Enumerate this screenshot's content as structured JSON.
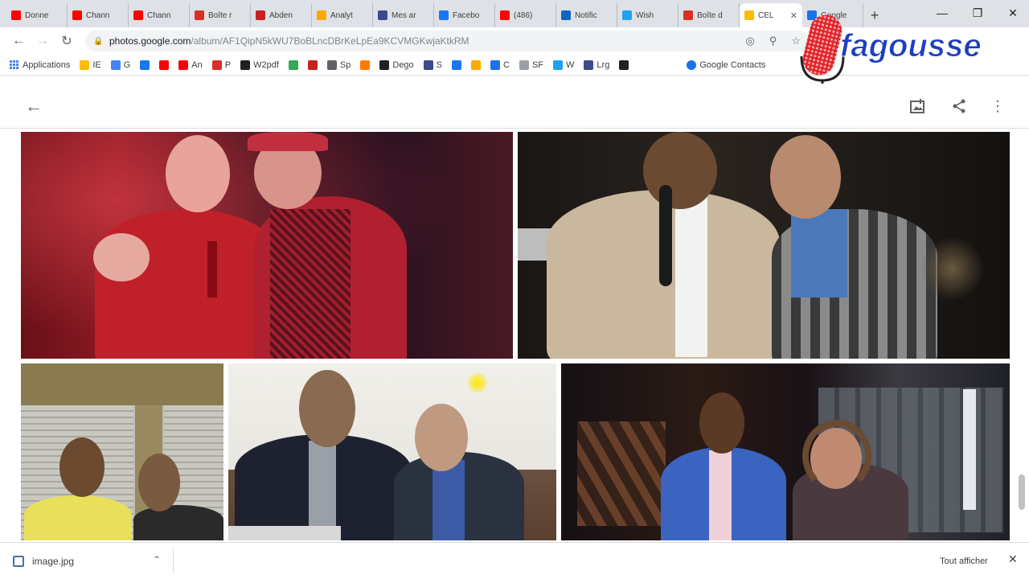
{
  "browser": {
    "tabs": [
      {
        "title": "Donne",
        "favicon": "youtube-icon",
        "color": "#ff0000"
      },
      {
        "title": "Chann",
        "favicon": "youtube-icon",
        "color": "#ff0000"
      },
      {
        "title": "Chann",
        "favicon": "youtube-icon",
        "color": "#ff0000"
      },
      {
        "title": "Boîte r",
        "favicon": "gmail-icon",
        "color": "#d93025"
      },
      {
        "title": "Abden",
        "favicon": "site-icon",
        "color": "#c5221f"
      },
      {
        "title": "Analyt",
        "favicon": "analytics-icon",
        "color": "#f9ab00"
      },
      {
        "title": "Mes ar",
        "favicon": "star-icon",
        "color": "#3c4b8c"
      },
      {
        "title": "Facebo",
        "favicon": "facebook-icon",
        "color": "#1877f2"
      },
      {
        "title": "(486)",
        "favicon": "youtube-icon",
        "color": "#ff0000"
      },
      {
        "title": "Notific",
        "favicon": "linkedin-icon",
        "color": "#0a66c2"
      },
      {
        "title": "Wish",
        "favicon": "twitter-icon",
        "color": "#1da1f2"
      },
      {
        "title": "Boîte d",
        "favicon": "gmail-icon",
        "color": "#d93025"
      },
      {
        "title": "CEL",
        "favicon": "google-photos-icon",
        "color": "#fbbc04",
        "active": true
      },
      {
        "title": "Google",
        "favicon": "google-docs-icon",
        "color": "#1a73e8"
      }
    ],
    "new_tab": "+",
    "url_host": "photos.google.com",
    "url_path": "/album/AF1QipN5kWU7BoBLncDBrKeLpEa9KCVMGKwjaKtkRM",
    "bookmarks": [
      {
        "label": "Applications",
        "icon": "apps-grid-icon",
        "color": "#4285f4"
      },
      {
        "label": "IE",
        "icon": "bookmark-icon",
        "color": "#fbbc04"
      },
      {
        "label": "G",
        "icon": "google-icon",
        "color": "#4285f4"
      },
      {
        "label": "",
        "icon": "facebook-icon",
        "color": "#1877f2"
      },
      {
        "label": "",
        "icon": "youtube-icon",
        "color": "#ff0000"
      },
      {
        "label": "An",
        "icon": "youtube-icon",
        "color": "#ff0000"
      },
      {
        "label": "P",
        "icon": "gmail-icon",
        "color": "#d93025"
      },
      {
        "label": "W2pdf",
        "icon": "dash-icon",
        "color": "#202124"
      },
      {
        "label": "",
        "icon": "map-pin-icon",
        "color": "#34a853"
      },
      {
        "label": "",
        "icon": "site-icon",
        "color": "#c5221f"
      },
      {
        "label": "Sp",
        "icon": "gauge-icon",
        "color": "#5f6368"
      },
      {
        "label": "",
        "icon": "orange-icon",
        "color": "#ff7900"
      },
      {
        "label": "Dego",
        "icon": "globe-icon",
        "color": "#202124"
      },
      {
        "label": "S",
        "icon": "star-icon",
        "color": "#3c4b8c"
      },
      {
        "label": "",
        "icon": "facebook-icon",
        "color": "#1877f2"
      },
      {
        "label": "",
        "icon": "analytics-icon",
        "color": "#f9ab00"
      },
      {
        "label": "C",
        "icon": "chevron-right-icon",
        "color": "#1a73e8"
      },
      {
        "label": "SF",
        "icon": "triangle-icon",
        "color": "#9aa0a6"
      },
      {
        "label": "W",
        "icon": "twitter-icon",
        "color": "#1da1f2"
      },
      {
        "label": "Lrg",
        "icon": "site-icon",
        "color": "#3c4b8c"
      },
      {
        "label": "",
        "icon": "dots-icon",
        "color": "#202124"
      }
    ],
    "bookmark_end": "Google Contacts"
  },
  "watermark": {
    "brand": "fagousse"
  },
  "photos": {
    "download": {
      "filename": "image.jpg",
      "show_all": "Tout afficher"
    }
  }
}
